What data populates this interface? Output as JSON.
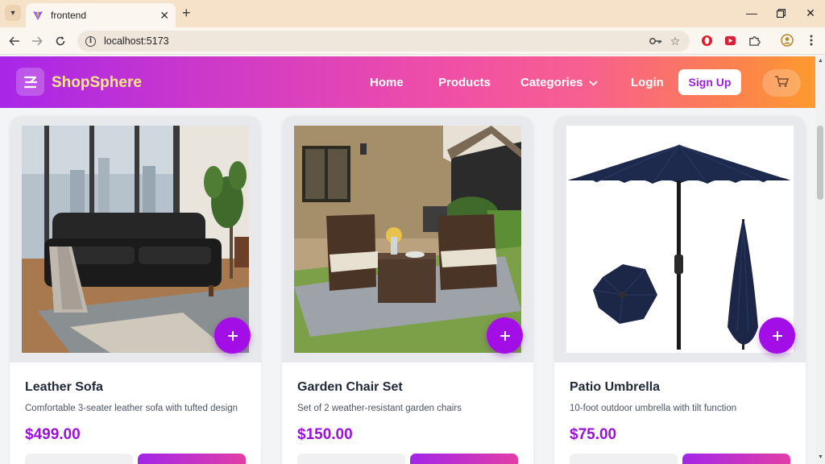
{
  "browser": {
    "tab_title": "frontend",
    "new_tab_label": "+",
    "url": "localhost:5173"
  },
  "header": {
    "brand": "ShopSphere",
    "nav": {
      "home": "Home",
      "products": "Products",
      "categories": "Categories",
      "login": "Login",
      "signup": "Sign Up"
    }
  },
  "products": [
    {
      "name": "Leather Sofa",
      "description": "Comfortable 3-seater leather sofa with tufted design",
      "price": "$499.00",
      "add_icon": "plus-icon"
    },
    {
      "name": "Garden Chair Set",
      "description": "Set of 2 weather-resistant garden chairs",
      "price": "$150.00",
      "add_icon": "plus-icon"
    },
    {
      "name": "Patio Umbrella",
      "description": "10-foot outdoor umbrella with tilt function",
      "price": "$75.00",
      "add_icon": "plus-icon"
    }
  ],
  "colors": {
    "accent": "#a30ee6",
    "price": "#9b11d9",
    "brand_text": "#fde68a",
    "header_gradient_start": "#a726e8",
    "header_gradient_end": "#fd9a2e"
  }
}
